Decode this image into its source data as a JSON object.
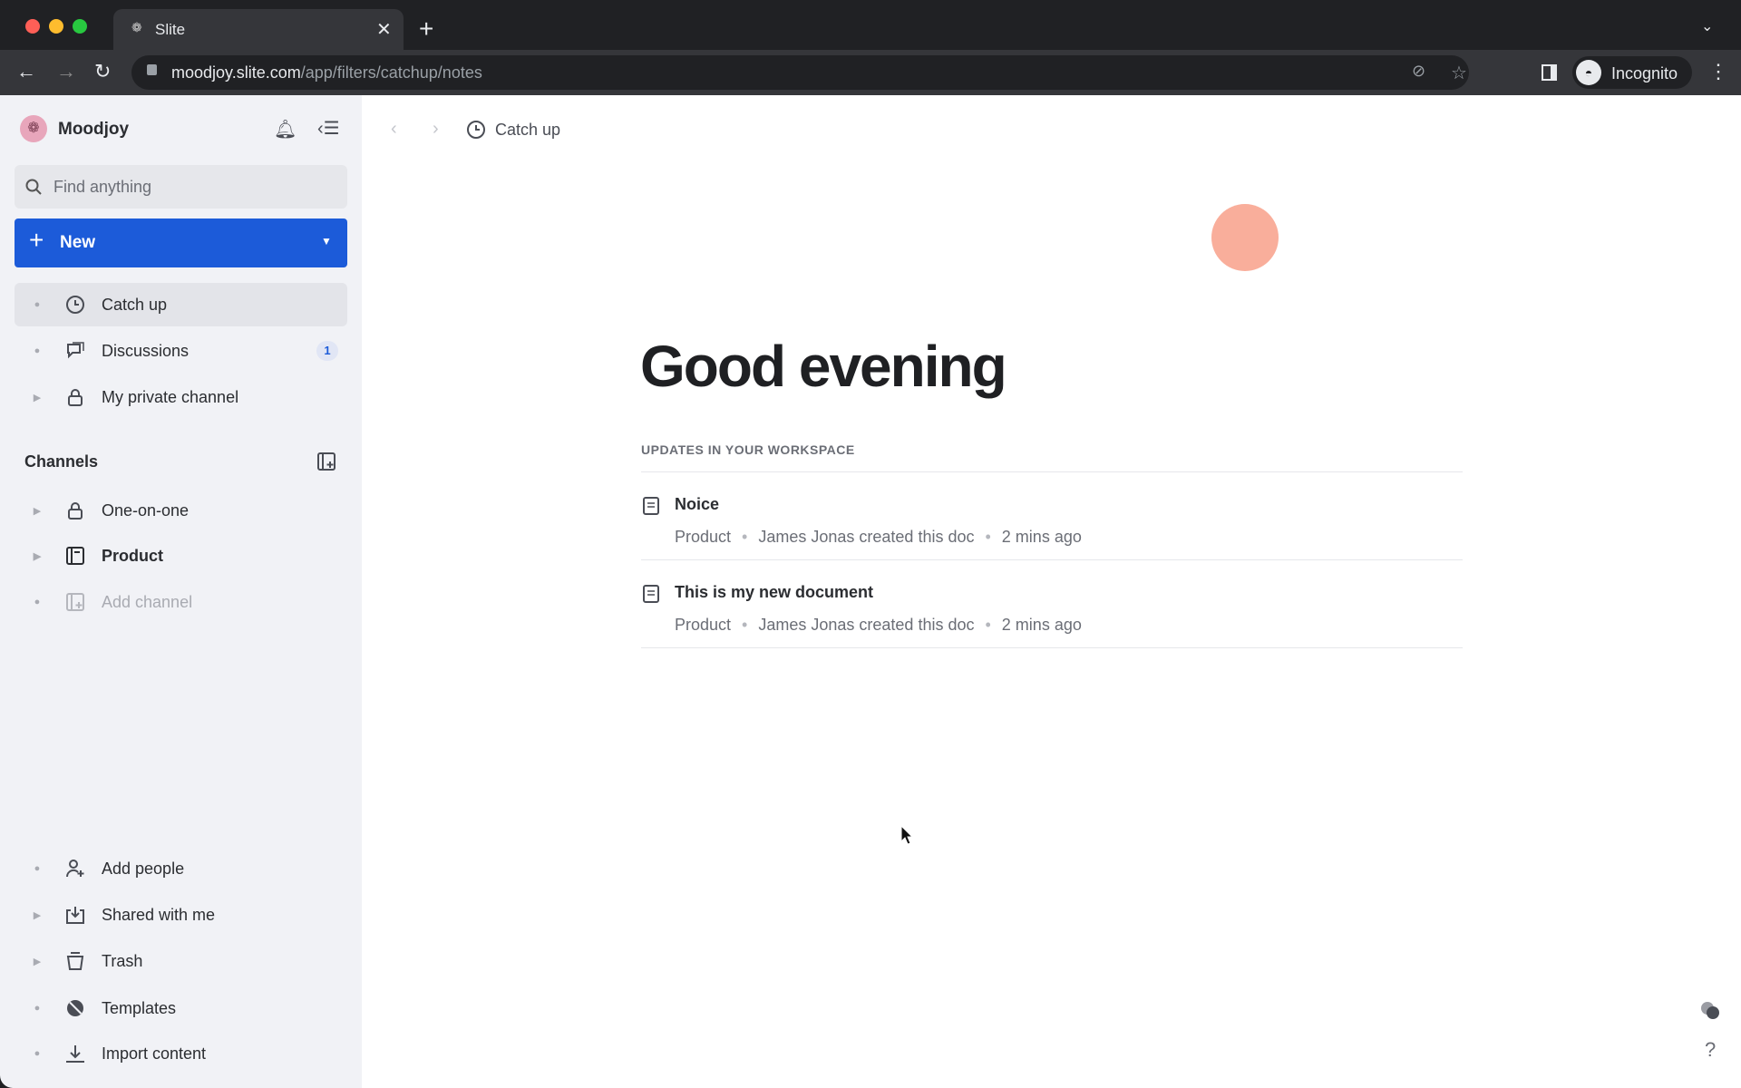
{
  "browser": {
    "tab_title": "Slite",
    "url_host": "moodjoy.slite.com",
    "url_path": "/app/filters/catchup/notes",
    "profile": "Incognito"
  },
  "sidebar": {
    "workspace": "Moodjoy",
    "search_placeholder": "Find anything",
    "new_label": "New",
    "top_items": [
      {
        "label": "Catch up",
        "icon": "clock-icon"
      },
      {
        "label": "Discussions",
        "icon": "chat-icon",
        "badge": "1"
      },
      {
        "label": "My private channel",
        "icon": "lock-icon"
      }
    ],
    "channels_title": "Channels",
    "channels": [
      {
        "label": "One-on-one",
        "icon": "lock-icon"
      },
      {
        "label": "Product",
        "icon": "channel-icon"
      },
      {
        "label": "Add channel",
        "icon": "add-channel-icon"
      }
    ],
    "bottom_items": [
      {
        "label": "Add people"
      },
      {
        "label": "Shared with me"
      },
      {
        "label": "Trash"
      },
      {
        "label": "Templates"
      },
      {
        "label": "Import content"
      }
    ]
  },
  "main": {
    "breadcrumb": "Catch up",
    "greeting": "Good evening",
    "section_title": "UPDATES IN YOUR WORKSPACE",
    "updates": [
      {
        "title": "Noice",
        "channel": "Product",
        "action": "James Jonas created this doc",
        "time": "2 mins ago"
      },
      {
        "title": "This is my new document",
        "channel": "Product",
        "action": "James Jonas created this doc",
        "time": "2 mins ago"
      }
    ],
    "help": "?"
  },
  "colors": {
    "accent": "#1c5bd9",
    "avatar": "#f9ae9b"
  }
}
